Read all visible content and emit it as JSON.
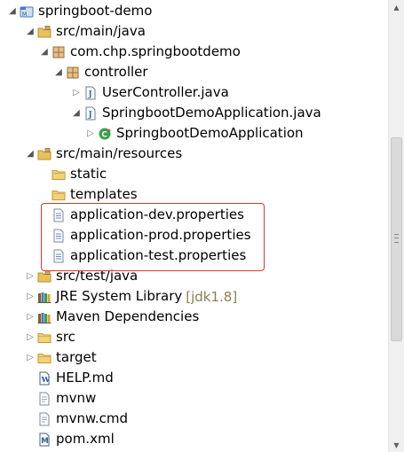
{
  "tree": [
    {
      "label": "springboot-demo",
      "icon": "project-icon",
      "twisty": "expanded"
    },
    {
      "label": "src/main/java",
      "icon": "source-folder-icon",
      "twisty": "expanded"
    },
    {
      "label": "com.chp.springbootdemo",
      "icon": "package-icon",
      "twisty": "expanded"
    },
    {
      "label": "controller",
      "icon": "package-icon",
      "twisty": "expanded"
    },
    {
      "label": "UserController.java",
      "icon": "java-file-icon",
      "twisty": "collapsed"
    },
    {
      "label": "SpringbootDemoApplication.java",
      "icon": "java-file-icon",
      "twisty": "expanded"
    },
    {
      "label": "SpringbootDemoApplication",
      "icon": "class-icon",
      "twisty": "collapsed"
    },
    {
      "label": "src/main/resources",
      "icon": "source-folder-icon",
      "twisty": "expanded"
    },
    {
      "label": "static",
      "icon": "folder-icon",
      "twisty": "none"
    },
    {
      "label": "templates",
      "icon": "folder-icon",
      "twisty": "none"
    },
    {
      "label": "application-dev.properties",
      "icon": "properties-file-icon",
      "twisty": "none"
    },
    {
      "label": "application-prod.properties",
      "icon": "properties-file-icon",
      "twisty": "none"
    },
    {
      "label": "application-test.properties",
      "icon": "properties-file-icon",
      "twisty": "none"
    },
    {
      "label": "src/test/java",
      "icon": "source-folder-icon",
      "twisty": "collapsed"
    },
    {
      "label": "JRE System Library",
      "decoration": "[jdk1.8]",
      "icon": "library-icon",
      "twisty": "collapsed"
    },
    {
      "label": "Maven Dependencies",
      "icon": "library-icon",
      "twisty": "collapsed"
    },
    {
      "label": "src",
      "icon": "folder-icon",
      "twisty": "collapsed"
    },
    {
      "label": "target",
      "icon": "folder-icon",
      "twisty": "collapsed"
    },
    {
      "label": "HELP.md",
      "icon": "markdown-file-icon",
      "twisty": "none"
    },
    {
      "label": "mvnw",
      "icon": "text-file-icon",
      "twisty": "none"
    },
    {
      "label": "mvnw.cmd",
      "icon": "text-file-icon",
      "twisty": "none"
    },
    {
      "label": "pom.xml",
      "icon": "xml-file-icon",
      "twisty": "none"
    }
  ],
  "colors": {
    "highlight_border": "#e03333",
    "decoration_text": "#8b7d4e",
    "folder": "#e8c15a",
    "package": "#b0824a",
    "java": "#3b6fb6",
    "class_green": "#3aa043"
  }
}
